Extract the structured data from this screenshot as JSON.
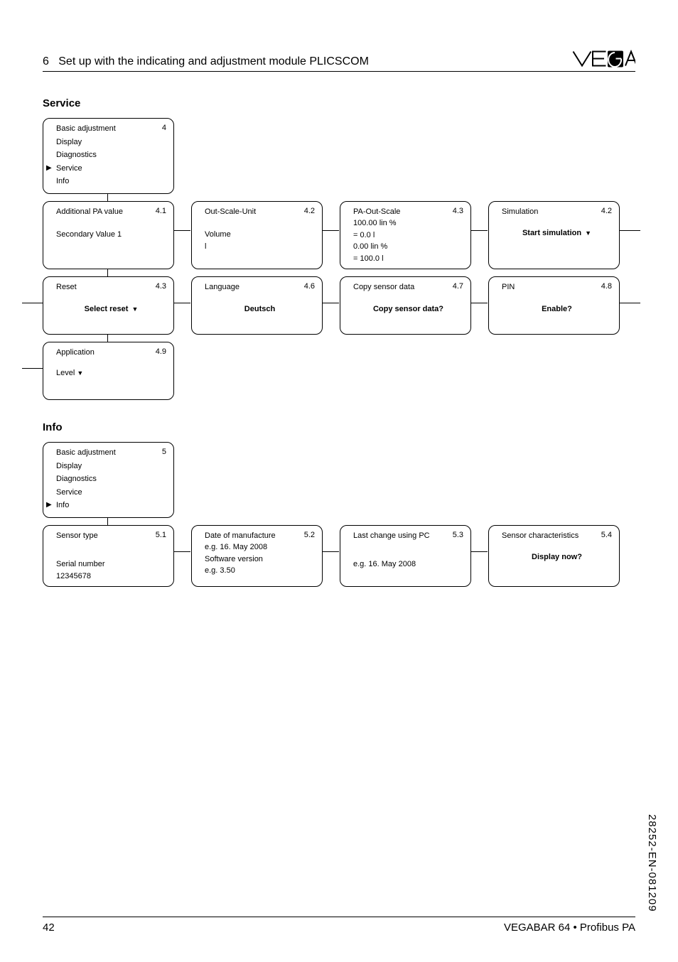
{
  "header": {
    "section_no": "6",
    "title": "Set up with the indicating and adjustment module PLICSCOM"
  },
  "service": {
    "heading": "Service",
    "menu_card": {
      "num": "4",
      "items": [
        "Basic adjustment",
        "Display",
        "Diagnostics",
        "Service",
        "Info"
      ],
      "selected_index": 3
    },
    "cards": [
      {
        "num": "4.1",
        "line1": "Additional PA value",
        "line2": "Secondary Value 1"
      },
      {
        "num": "4.2",
        "line1": "Out-Scale-Unit",
        "line2": "Volume",
        "line3": "l"
      },
      {
        "num": "4.3",
        "line1": "PA-Out-Scale",
        "lines": [
          "100.00 lin %",
          "= 0.0 l",
          "0.00 lin %",
          "= 100.0 l"
        ]
      },
      {
        "num": "4.2",
        "line1": "Simulation",
        "action": "Start simulation"
      },
      {
        "num": "4.3",
        "line1": "Reset",
        "action": "Select reset"
      },
      {
        "num": "4.6",
        "line1": "Language",
        "center": "Deutsch"
      },
      {
        "num": "4.7",
        "line1": "Copy sensor data",
        "center": "Copy sensor data?"
      },
      {
        "num": "4.8",
        "line1": "PIN",
        "center": "Enable?"
      },
      {
        "num": "4.9",
        "line1": "Application",
        "action_plain": "Level"
      }
    ]
  },
  "info": {
    "heading": "Info",
    "menu_card": {
      "num": "5",
      "items": [
        "Basic adjustment",
        "Display",
        "Diagnostics",
        "Service",
        "Info"
      ],
      "selected_index": 4
    },
    "cards": [
      {
        "num": "5.1",
        "line1": "Sensor type",
        "line2": "Serial number",
        "line3": "12345678"
      },
      {
        "num": "5.2",
        "line1": "Date of manufacture",
        "line2": "e.g. 16. May 2008",
        "line3": "Software version",
        "line4": "e.g. 3.50"
      },
      {
        "num": "5.3",
        "line1": "Last change using PC",
        "line2": "e.g. 16. May 2008"
      },
      {
        "num": "5.4",
        "line1": "Sensor characteristics",
        "center": "Display now?"
      }
    ]
  },
  "footer": {
    "page": "42",
    "product": "VEGABAR 64 • Profibus PA"
  },
  "doc_id": "28252-EN-081209"
}
